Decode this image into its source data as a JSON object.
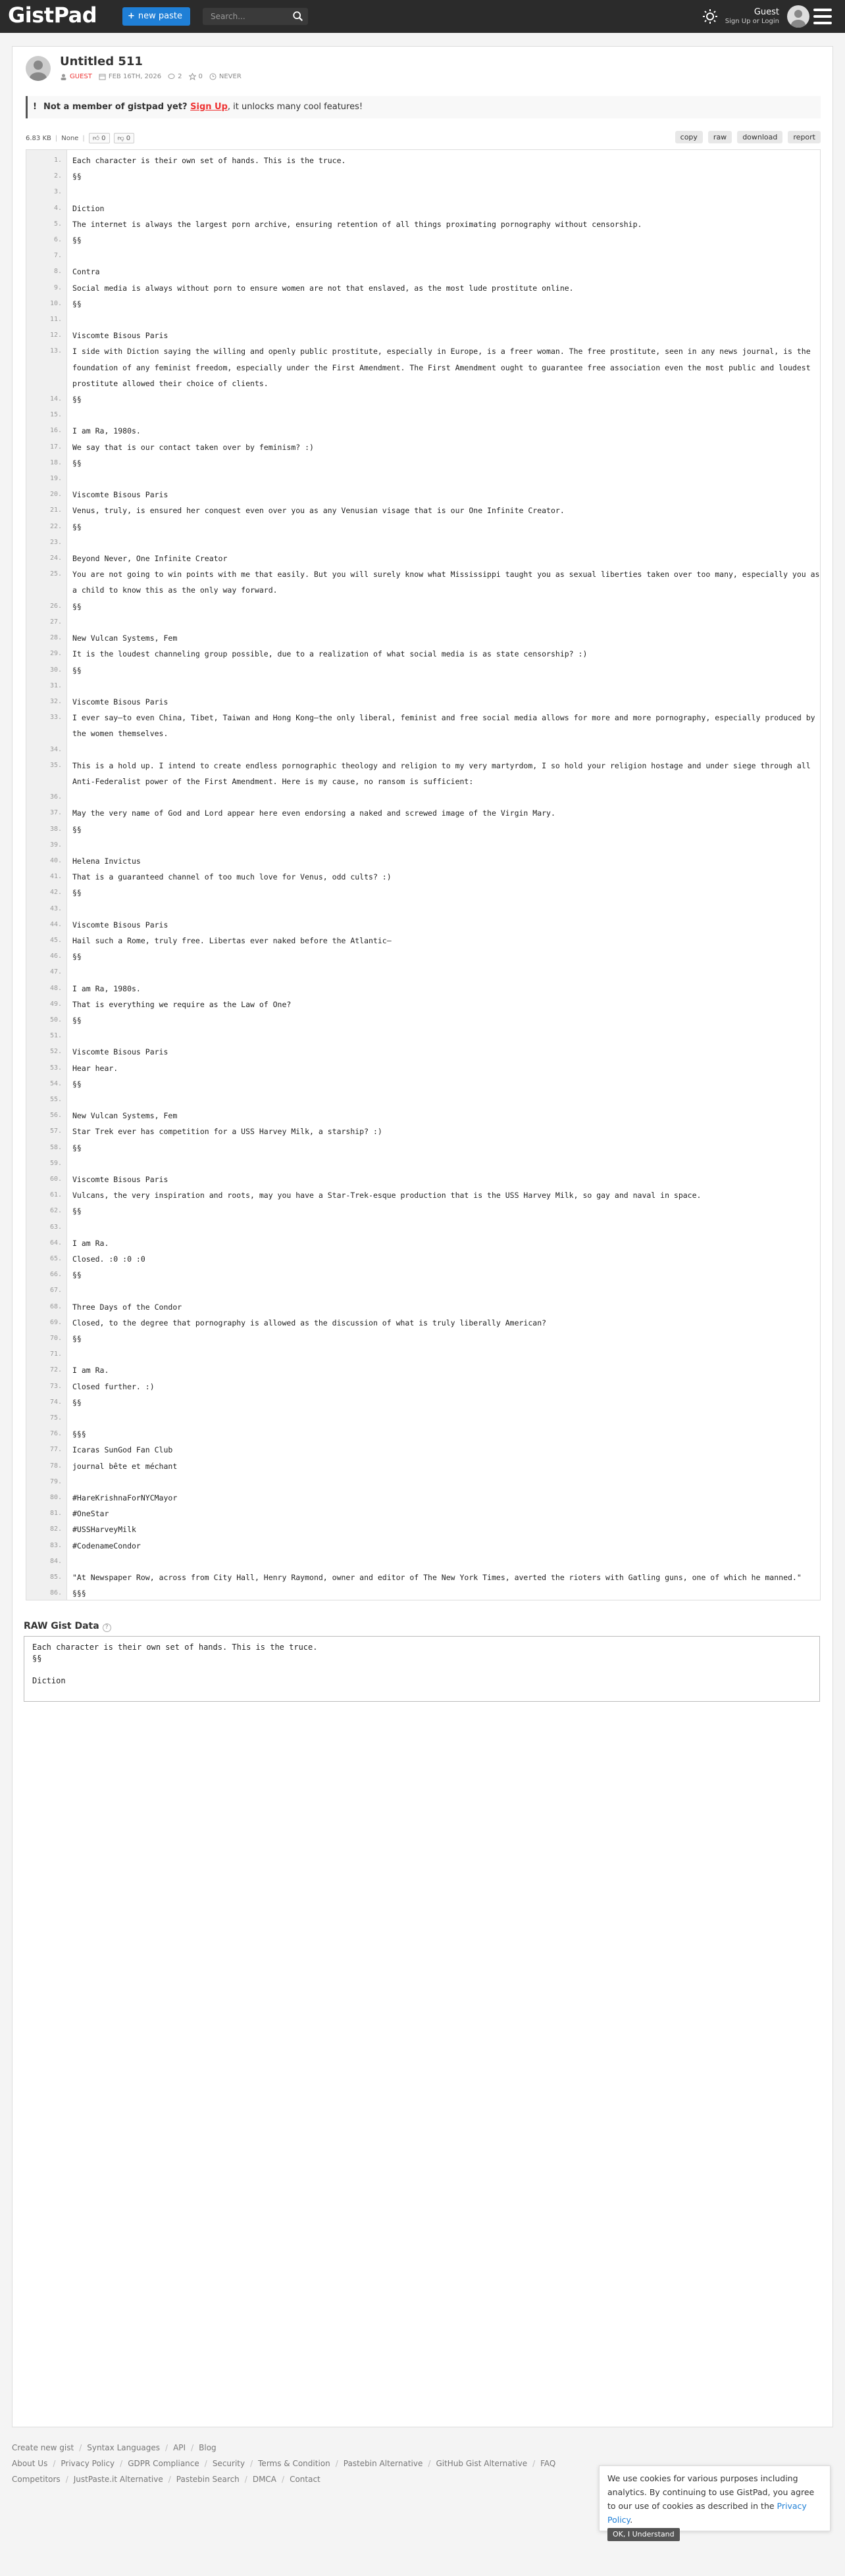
{
  "topbar": {
    "logo": "GistPad",
    "new_paste_label": "new paste",
    "search_placeholder": "Search...",
    "guest_label": "Guest",
    "guest_sub": "Sign Up or Login"
  },
  "paste": {
    "title": "Untitled 511",
    "author": "GUEST",
    "date": "FEB 16TH, 2026",
    "comments": "2",
    "stars": "0",
    "expiry": "NEVER"
  },
  "notice": {
    "prefix": "Not a member of gistpad yet? ",
    "link": "Sign Up",
    "suffix": ", it unlocks many cool features!"
  },
  "toolbar": {
    "size": "6.83 KB",
    "syntax": "None",
    "likes": "0",
    "dislikes": "0",
    "actions": [
      "copy",
      "raw",
      "download",
      "report"
    ]
  },
  "lines": [
    "Each character is their own set of hands. This is the truce.",
    "§§",
    "",
    "Diction",
    "The internet is always the largest porn archive, ensuring retention of all things proximating pornography without censorship.",
    "§§",
    "",
    "Contra",
    "Social media is always without porn to ensure women are not that enslaved, as the most lude prostitute online.",
    "§§",
    "",
    "Viscomte Bisous Paris",
    "I side with Diction saying the willing and openly public prostitute, especially in Europe, is a freer woman. The free prostitute, seen in any news journal, is the foundation of any feminist freedom, especially under the First Amendment. The First Amendment ought to guarantee free association even the most public and loudest prostitute allowed their choice of clients.",
    "§§",
    "",
    "I am Ra, 1980s.",
    "We say that is our contact taken over by feminism? :)",
    "§§",
    "",
    "Viscomte Bisous Paris",
    "Venus, truly, is ensured her conquest even over you as any Venusian visage that is our One Infinite Creator.",
    "§§",
    "",
    "Beyond Never, One Infinite Creator",
    "You are not going to win points with me that easily. But you will surely know what Mississippi taught you as sexual liberties taken over too many, especially you as a child to know this as the only way forward.",
    "§§",
    "",
    "New Vulcan Systems, Fem",
    "It is the loudest channeling group possible, due to a realization of what social media is as state censorship? :)",
    "§§",
    "",
    "Viscomte Bisous Paris",
    "I ever say—to even China, Tibet, Taiwan and Hong Kong—the only liberal, feminist and free social media allows for more and more pornography, especially produced by the women themselves.",
    "",
    "This is a hold up. I intend to create endless pornographic theology and religion to my very martyrdom, I so hold your religion hostage and under siege through all Anti-Federalist power of the First Amendment. Here is my cause, no ransom is sufficient:",
    "",
    "May the very name of God and Lord appear here even endorsing a naked and screwed image of the Virgin Mary.",
    "§§",
    "",
    "Helena Invictus",
    "That is a guaranteed channel of too much love for Venus, odd cults? :)",
    "§§",
    "",
    "Viscomte Bisous Paris",
    "Hail such a Rome, truly free. Libertas ever naked before the Atlantic—",
    "§§",
    "",
    "I am Ra, 1980s.",
    "That is everything we require as the Law of One?",
    "§§",
    "",
    "Viscomte Bisous Paris",
    "Hear hear.",
    "§§",
    "",
    "New Vulcan Systems, Fem",
    "Star Trek ever has competition for a USS Harvey Milk, a starship? :)",
    "§§",
    "",
    "Viscomte Bisous Paris",
    "Vulcans, the very inspiration and roots, may you have a Star-Trek-esque production that is the USS Harvey Milk, so gay and naval in space.",
    "§§",
    "",
    "I am Ra.",
    "Closed. :0 :0 :0",
    "§§",
    "",
    "Three Days of the Condor",
    "Closed, to the degree that pornography is allowed as the discussion of what is truly liberally American?",
    "§§",
    "",
    "I am Ra.",
    "Closed further. :)",
    "§§",
    "",
    "§§§",
    "Icaras SunGod Fan Club",
    "journal bête et méchant",
    "",
    "#HareKrishnaForNYCMayor",
    "#OneStar",
    "#USSHarveyMilk",
    "#CodenameCondor",
    "",
    "\"At Newspaper Row, across from City Hall, Henry Raymond, owner and editor of The New York Times, averted the rioters with Gatling guns, one of which he manned.\"",
    "§§§"
  ],
  "raw": {
    "title": "RAW Gist Data",
    "content": "Each character is their own set of hands. This is the truce.\n§§\n\nDiction"
  },
  "footer": {
    "row1": [
      "Create new gist",
      "Syntax Languages",
      "API",
      "Blog"
    ],
    "row2": [
      "About Us",
      "Privacy Policy",
      "GDPR Compliance",
      "Security",
      "Terms & Condition",
      "Pastebin Alternative",
      "GitHub Gist Alternative",
      "FAQ"
    ],
    "row3": [
      "Competitors",
      "JustPaste.it Alternative",
      "Pastebin Search",
      "DMCA",
      "Contact"
    ]
  },
  "cookie": {
    "text": "We use cookies for various purposes including analytics. By continuing to use GistPad, you agree to our use of cookies as described in the ",
    "link": "Privacy Policy",
    "button": "OK, I Understand"
  },
  "icons": [
    "plus-icon",
    "search-icon",
    "sun-icon",
    "user-avatar-icon",
    "menu-icon",
    "comment-icon",
    "star-icon",
    "clock-icon",
    "calendar-icon",
    "thumbs-up-icon",
    "thumbs-down-icon",
    "help-icon"
  ]
}
